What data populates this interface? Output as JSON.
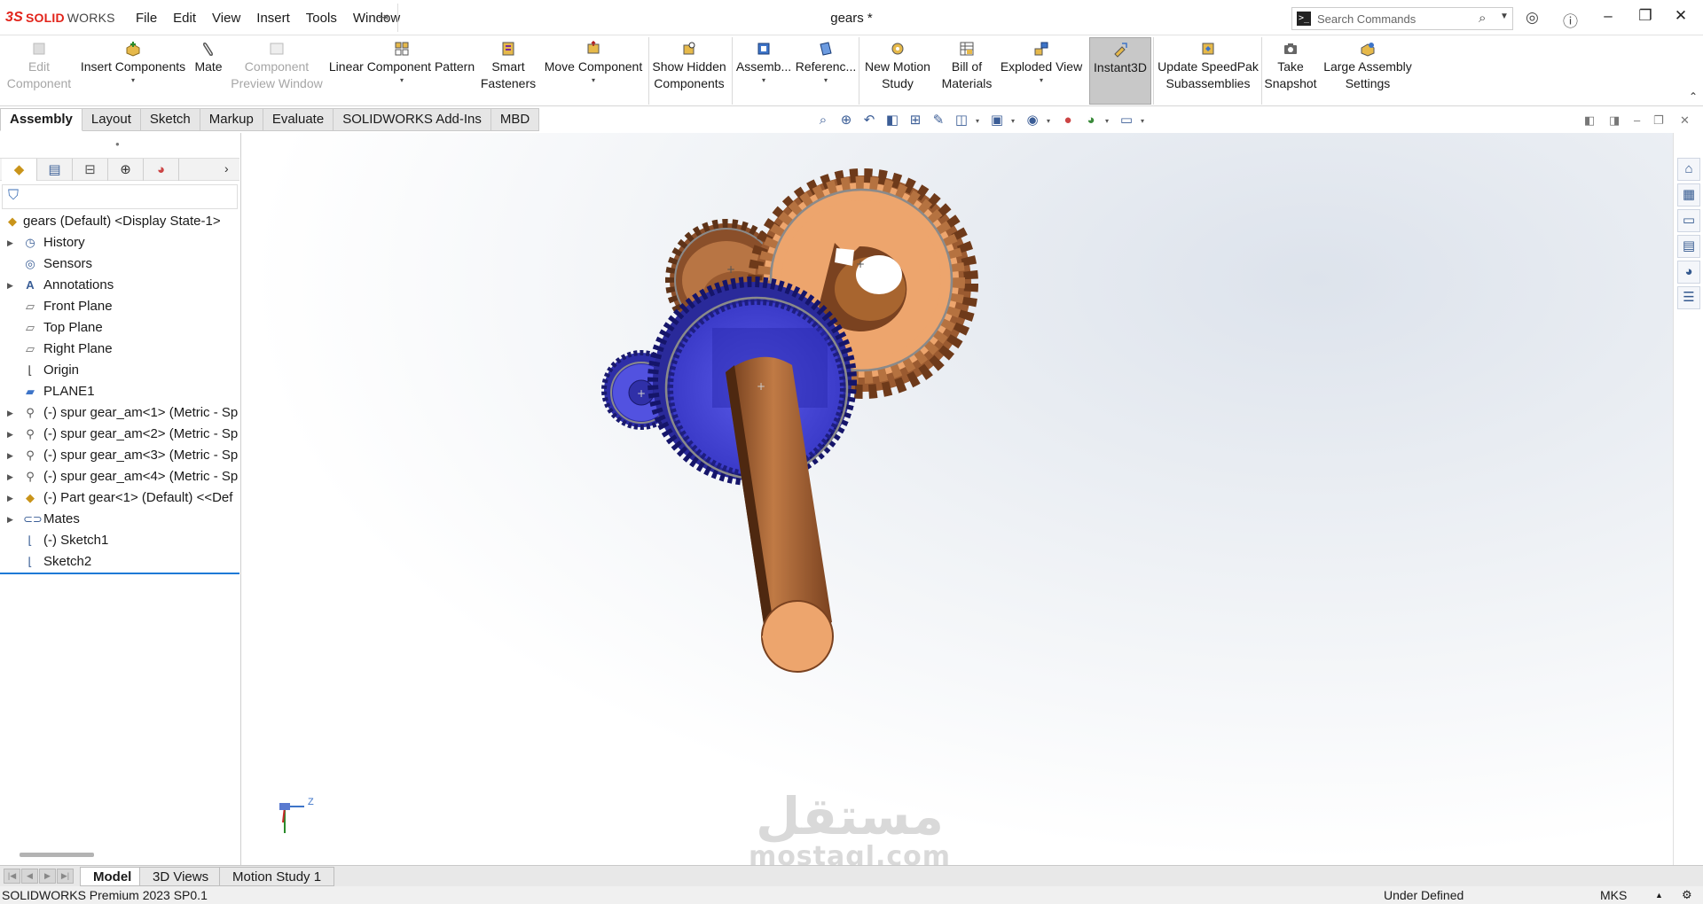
{
  "app": {
    "logo_ds": "3S",
    "logo_brand_bold": "SOLID",
    "logo_brand_light": "WORKS",
    "document_title": "gears *",
    "menu": [
      "File",
      "Edit",
      "View",
      "Insert",
      "Tools",
      "Window"
    ],
    "search_placeholder": "Search Commands"
  },
  "ribbon": {
    "edit_component": "Edit\nComponent",
    "insert_components": "Insert Components",
    "mate": "Mate",
    "component_preview_window": "Component\nPreview Window",
    "linear_component_pattern": "Linear Component Pattern",
    "smart_fasteners": "Smart\nFasteners",
    "move_component": "Move Component",
    "show_hidden_components": "Show Hidden\nComponents",
    "assembly_features": "Assemb...",
    "reference_geometry": "Referenc...",
    "new_motion_study": "New Motion\nStudy",
    "bill_of_materials": "Bill of\nMaterials",
    "exploded_view": "Exploded View",
    "instant3d": "Instant3D",
    "update_speedpak": "Update SpeedPak\nSubassemblies",
    "take_snapshot": "Take\nSnapshot",
    "large_assembly_settings": "Large Assembly\nSettings"
  },
  "command_tabs": [
    "Assembly",
    "Layout",
    "Sketch",
    "Markup",
    "Evaluate",
    "SOLIDWORKS Add-Ins",
    "MBD"
  ],
  "tree": {
    "root": "gears (Default) <Display State-1>",
    "items": [
      {
        "label": "History"
      },
      {
        "label": "Sensors"
      },
      {
        "label": "Annotations"
      },
      {
        "label": "Front Plane"
      },
      {
        "label": "Top Plane"
      },
      {
        "label": "Right Plane"
      },
      {
        "label": "Origin"
      },
      {
        "label": "PLANE1"
      },
      {
        "label": "(-) spur gear_am<1> (Metric - Sp"
      },
      {
        "label": "(-) spur gear_am<2> (Metric - Sp"
      },
      {
        "label": "(-) spur gear_am<3> (Metric - Sp"
      },
      {
        "label": "(-) spur gear_am<4> (Metric - Sp"
      },
      {
        "label": "(-) Part gear<1> (Default) <<Def"
      },
      {
        "label": "Mates"
      },
      {
        "label": "(-) Sketch1"
      },
      {
        "label": "Sketch2"
      }
    ]
  },
  "triad": {
    "z_label": "Z"
  },
  "watermark": {
    "arabic": "مستقل",
    "latin": "mostaql.com"
  },
  "bottom_tabs": [
    "Model",
    "3D Views",
    "Motion Study 1"
  ],
  "status": {
    "product": "SOLIDWORKS Premium 2023 SP0.1",
    "state": "Under Defined",
    "units": "MKS"
  },
  "colors": {
    "brand_red": "#e2231a",
    "gear_copper_light": "#eda56d",
    "gear_copper_dark": "#8a4f2a",
    "gear_blue": "#4a4ad8",
    "selection_blue": "#1e7ad6"
  }
}
